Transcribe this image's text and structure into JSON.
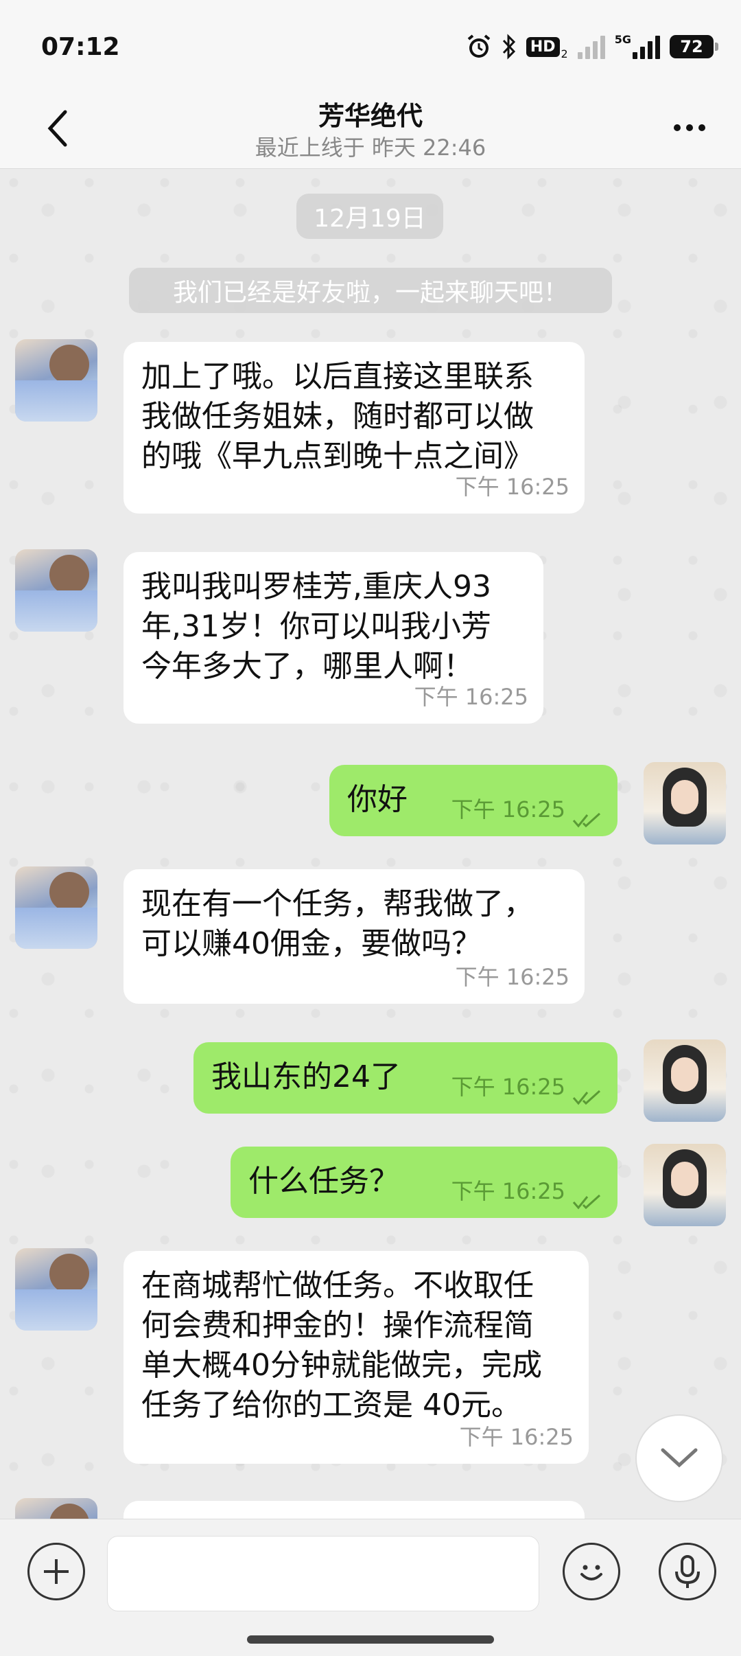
{
  "status_bar": {
    "time": "07:12",
    "hd_label": "HD",
    "hd_sub": "2",
    "network_label": "5G",
    "battery_percent": "72"
  },
  "header": {
    "title": "芳华绝代",
    "last_seen": "最近上线于 昨天 22:46"
  },
  "chat": {
    "date_divider": "12月19日",
    "system_message": "我们已经是好友啦，一起来聊天吧！",
    "messages": [
      {
        "direction": "in",
        "lines": [
          "加上了哦。以后直接这里联系",
          "我做任务姐妹，随时都可以做",
          "的哦《早九点到晚十点之间》"
        ],
        "time": "下午  16:25"
      },
      {
        "direction": "in",
        "lines": [
          "我叫我叫罗桂芳,重庆人93",
          "年,31岁！你可以叫我小芳",
          "今年多大了，哪里人啊！"
        ],
        "time": "下午  16:25"
      },
      {
        "direction": "out",
        "lines": [
          "你好"
        ],
        "time": "下午  16:25",
        "read": true
      },
      {
        "direction": "in",
        "lines": [
          "现在有一个任务，帮我做了，",
          "可以赚40佣金，要做吗？"
        ],
        "time": "下午  16:25"
      },
      {
        "direction": "out",
        "lines": [
          "我山东的24了"
        ],
        "time": "下午  16:25",
        "read": true
      },
      {
        "direction": "out",
        "lines": [
          "什么任务？"
        ],
        "time": "下午  16:25",
        "read": true
      },
      {
        "direction": "in",
        "lines": [
          "在商城帮忙做任务。不收取任",
          "何会费和押金的！操作流程简",
          "单大概40分钟就能做完，完成",
          "任务了给你的工资是 40元。"
        ],
        "time": "下午  16:25"
      }
    ]
  },
  "input_bar": {
    "placeholder": ""
  },
  "colors": {
    "outgoing_bubble": "#9eea6a",
    "incoming_bubble": "#ffffff",
    "chat_background": "#ebebeb"
  }
}
